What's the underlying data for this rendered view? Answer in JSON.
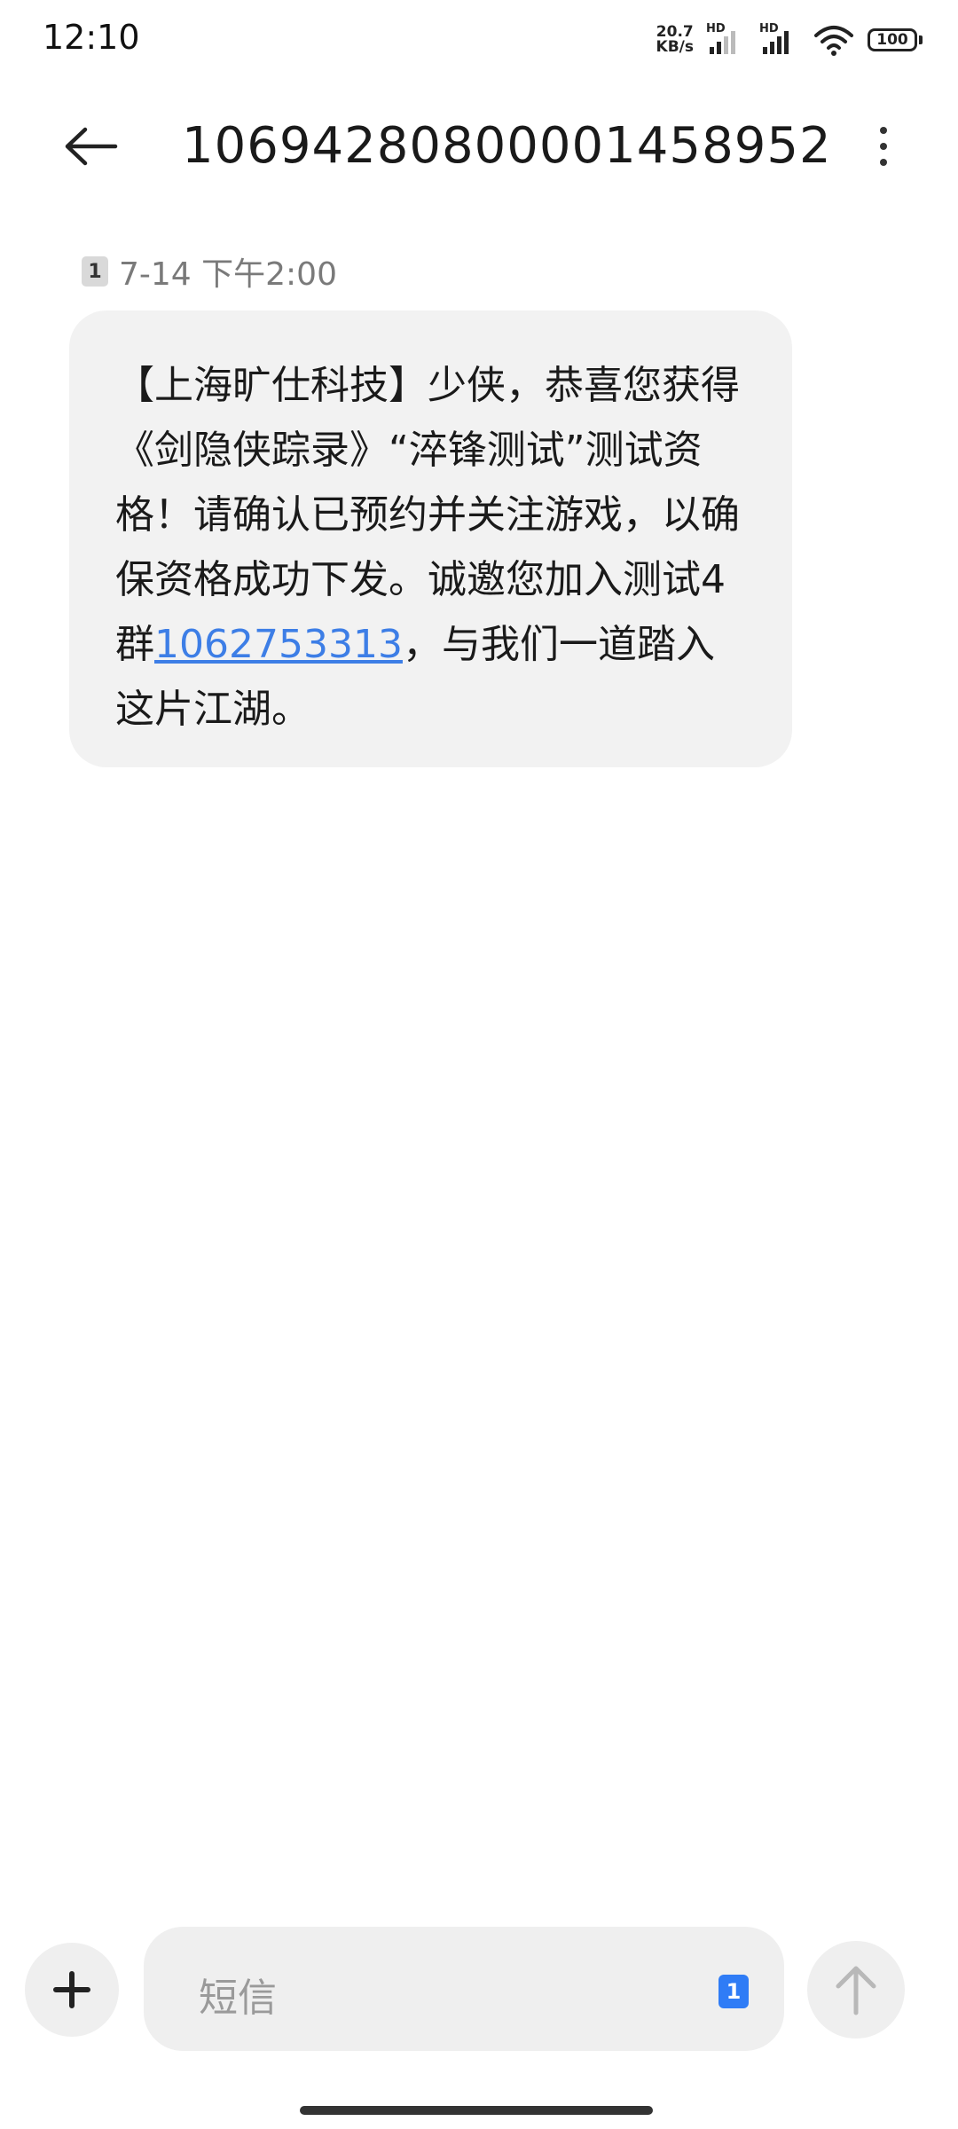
{
  "status_bar": {
    "time": "12:10",
    "net_speed_value": "20.7",
    "net_speed_unit": "KB/s",
    "sim1_label": "HD",
    "sim2_label": "HD",
    "battery": "100"
  },
  "header": {
    "title": "10694280800001458952",
    "back_icon": "arrow-left-icon",
    "more_icon": "more-vertical-icon"
  },
  "message": {
    "sim_slot": "1",
    "timestamp": "7-14 下午2:00",
    "text_before_link": "【上海旷仕科技】少侠，恭喜您获得《剑隐侠踪录》“淬锋测试”测试资格！请确认已预约并关注游戏，以确保资格成功下发。诚邀您加入测试4群",
    "link_text": "1062753313",
    "text_after_link": "，与我们一道踏入这片江湖。",
    "link_color": "#3d7ee6"
  },
  "composer": {
    "placeholder": "短信",
    "sim_slot": "1",
    "add_icon": "plus-icon",
    "send_icon": "arrow-up-icon",
    "accent_color": "#2f7cf6"
  }
}
